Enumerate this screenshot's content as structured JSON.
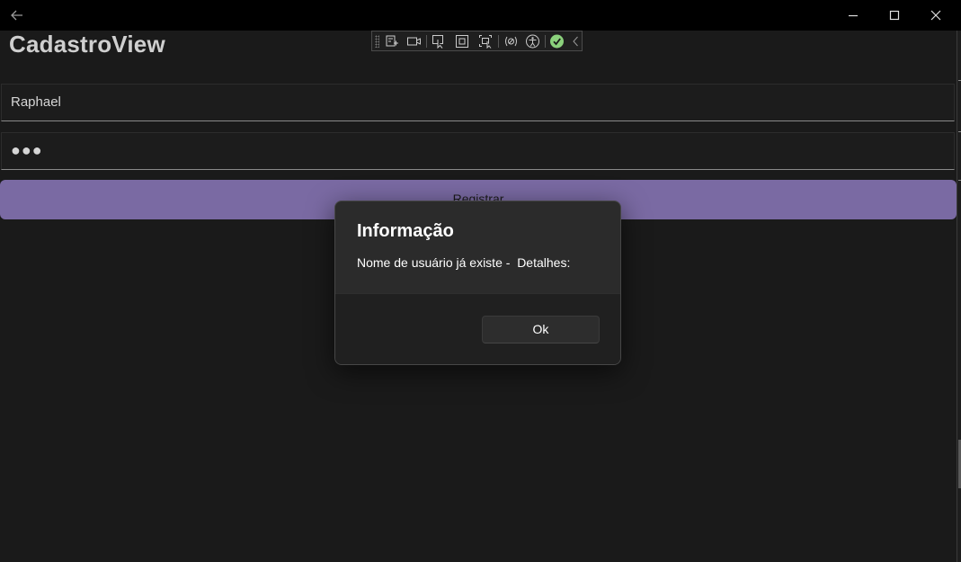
{
  "page": {
    "title": "CadastroView"
  },
  "form": {
    "username_value": "Raphael",
    "password_mask": "●●●",
    "register_label": "Registrar",
    "accent_color": "#7a6aa3"
  },
  "window": {
    "icons": [
      "back-arrow-icon",
      "minimize-icon",
      "maximize-icon",
      "close-icon"
    ]
  },
  "debug_toolbar": {
    "icons": [
      "live-visual-tree-icon",
      "record-icon",
      "select-element-icon",
      "display-layout-adorners-icon",
      "track-focus-icon",
      "binding-failures-icon",
      "accessibility-icon",
      "status-ok-icon",
      "collapse-toolbar-icon"
    ]
  },
  "dialog": {
    "title": "Informação",
    "message": "Nome de usuário já existe -  Detalhes:",
    "ok_label": "Ok"
  }
}
